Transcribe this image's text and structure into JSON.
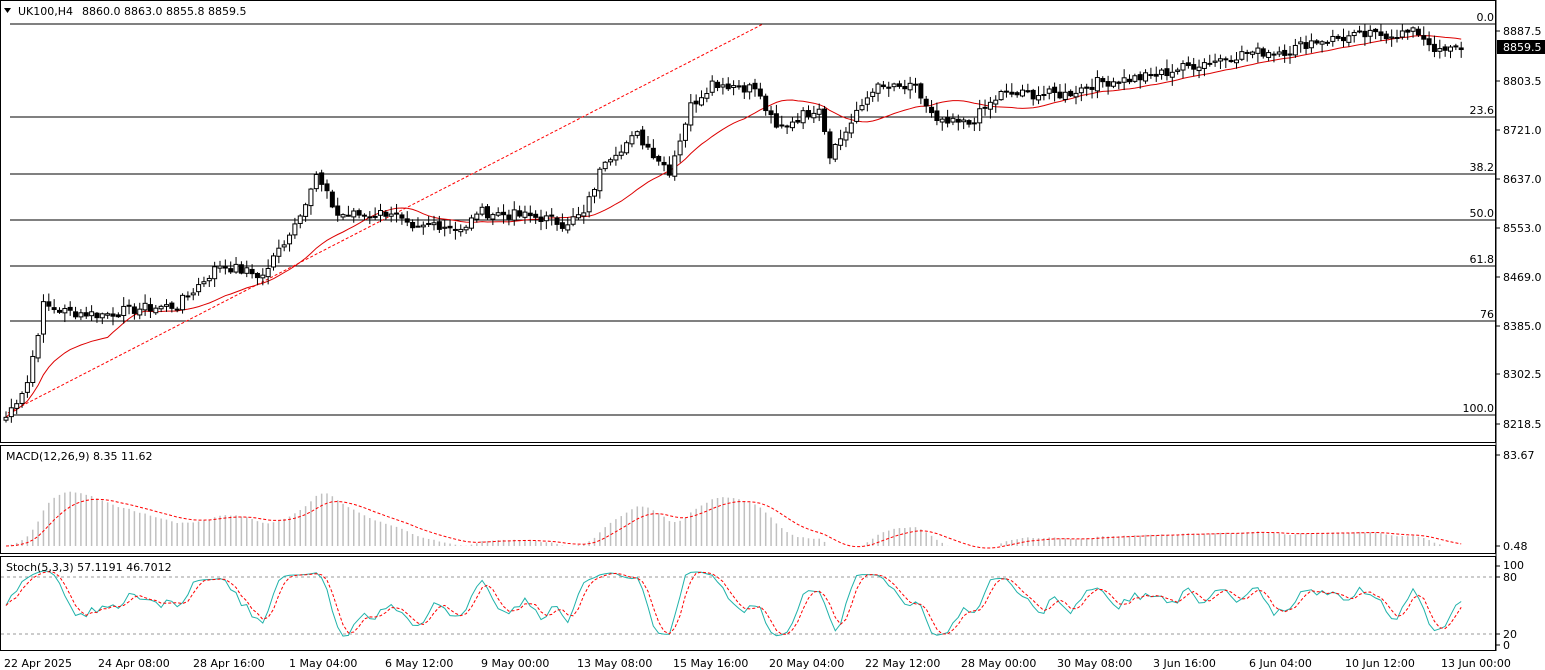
{
  "header": {
    "symbol": "UK100,H4",
    "ohlc": "8860.0 8863.0 8855.8 8859.5"
  },
  "price": {
    "current": "8859.5",
    "ticks": [
      "8887.5",
      "8803.5",
      "8721.0",
      "8637.0",
      "8553.0",
      "8469.0",
      "8385.0",
      "8302.5",
      "8218.5"
    ]
  },
  "fibonacci": {
    "levels": [
      "0.0",
      "23.6",
      "38.2",
      "50.0",
      "61.8",
      "76",
      "100.0"
    ]
  },
  "macd": {
    "label": "MACD(12,26,9) 8.35 11.62",
    "ticks": [
      "83.67",
      "0.48"
    ]
  },
  "stoch": {
    "label": "Stoch(5,3,3) 57.1191 46.7012",
    "ticks": [
      "100",
      "80",
      "20",
      "0"
    ]
  },
  "time_axis": {
    "labels": [
      "22 Apr 2025",
      "24 Apr 08:00",
      "28 Apr 16:00",
      "1 May 04:00",
      "6 May 12:00",
      "9 May 00:00",
      "13 May 08:00",
      "15 May 16:00",
      "20 May 04:00",
      "22 May 12:00",
      "28 May 00:00",
      "30 May 08:00",
      "3 Jun 16:00",
      "6 Jun 04:00",
      "10 Jun 12:00",
      "13 Jun 00:00"
    ]
  },
  "colors": {
    "background": "#ffffff",
    "bull_body": "#ffffff",
    "bear_body": "#000000",
    "ma_line": "#dd0000",
    "fib_trend": "#ff0000",
    "macd_hist": "#c0c0c0",
    "macd_signal": "#ff0000",
    "stoch_main": "#20b2aa",
    "stoch_signal": "#ff0000"
  },
  "chart_data": {
    "type": "candlestick",
    "symbol": "UK100",
    "timeframe": "H4",
    "waypoints": [
      [
        0,
        8230
      ],
      [
        4,
        8290
      ],
      [
        7,
        8420
      ],
      [
        11,
        8410
      ],
      [
        18,
        8405
      ],
      [
        25,
        8415
      ],
      [
        32,
        8420
      ],
      [
        40,
        8490
      ],
      [
        48,
        8470
      ],
      [
        54,
        8560
      ],
      [
        58,
        8640
      ],
      [
        62,
        8575
      ],
      [
        68,
        8575
      ],
      [
        72,
        8580
      ],
      [
        76,
        8545
      ],
      [
        80,
        8560
      ],
      [
        86,
        8550
      ],
      [
        88,
        8580
      ],
      [
        94,
        8575
      ],
      [
        100,
        8570
      ],
      [
        104,
        8560
      ],
      [
        108,
        8575
      ],
      [
        112,
        8670
      ],
      [
        118,
        8710
      ],
      [
        124,
        8650
      ],
      [
        128,
        8760
      ],
      [
        132,
        8800
      ],
      [
        140,
        8790
      ],
      [
        144,
        8720
      ],
      [
        152,
        8760
      ],
      [
        154,
        8680
      ],
      [
        158,
        8730
      ],
      [
        162,
        8790
      ],
      [
        170,
        8790
      ],
      [
        174,
        8730
      ],
      [
        180,
        8730
      ],
      [
        186,
        8780
      ],
      [
        198,
        8780
      ],
      [
        204,
        8800
      ],
      [
        214,
        8810
      ],
      [
        222,
        8830
      ],
      [
        232,
        8850
      ],
      [
        240,
        8855
      ],
      [
        244,
        8870
      ],
      [
        254,
        8880
      ],
      [
        264,
        8885
      ],
      [
        268,
        8850
      ],
      [
        272,
        8860
      ]
    ],
    "moving_average": true,
    "fibonacci_levels": [
      "0.0",
      "23.6",
      "38.2",
      "50.0",
      "61.8",
      "76",
      "100.0"
    ]
  }
}
